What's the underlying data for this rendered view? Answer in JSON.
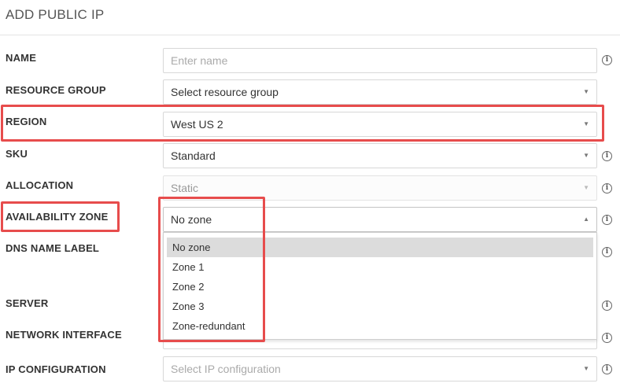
{
  "title": "ADD PUBLIC IP",
  "fields": {
    "name": {
      "label": "NAME",
      "placeholder": "Enter name"
    },
    "resource_group": {
      "label": "RESOURCE GROUP",
      "placeholder": "Select resource group"
    },
    "region": {
      "label": "REGION",
      "value": "West US 2"
    },
    "sku": {
      "label": "SKU",
      "value": "Standard"
    },
    "allocation": {
      "label": "ALLOCATION",
      "value": "Static"
    },
    "availability_zone": {
      "label": "AVAILABILITY ZONE",
      "value": "No zone",
      "options": [
        "No zone",
        "Zone 1",
        "Zone 2",
        "Zone 3",
        "Zone-redundant"
      ]
    },
    "dns_name_label": {
      "label": "DNS NAME LABEL"
    },
    "server": {
      "label": "SERVER"
    },
    "network_interface": {
      "label": "NETWORK INTERFACE"
    },
    "ip_configuration": {
      "label": "IP CONFIGURATION",
      "placeholder": "Select IP configuration"
    }
  },
  "icons": {
    "dropdown_caret": "▼",
    "dropdown_caret_up": "▲",
    "info": "i"
  },
  "colors": {
    "highlight": "#e74c4c",
    "selected_option_bg": "#dcdcdc"
  }
}
